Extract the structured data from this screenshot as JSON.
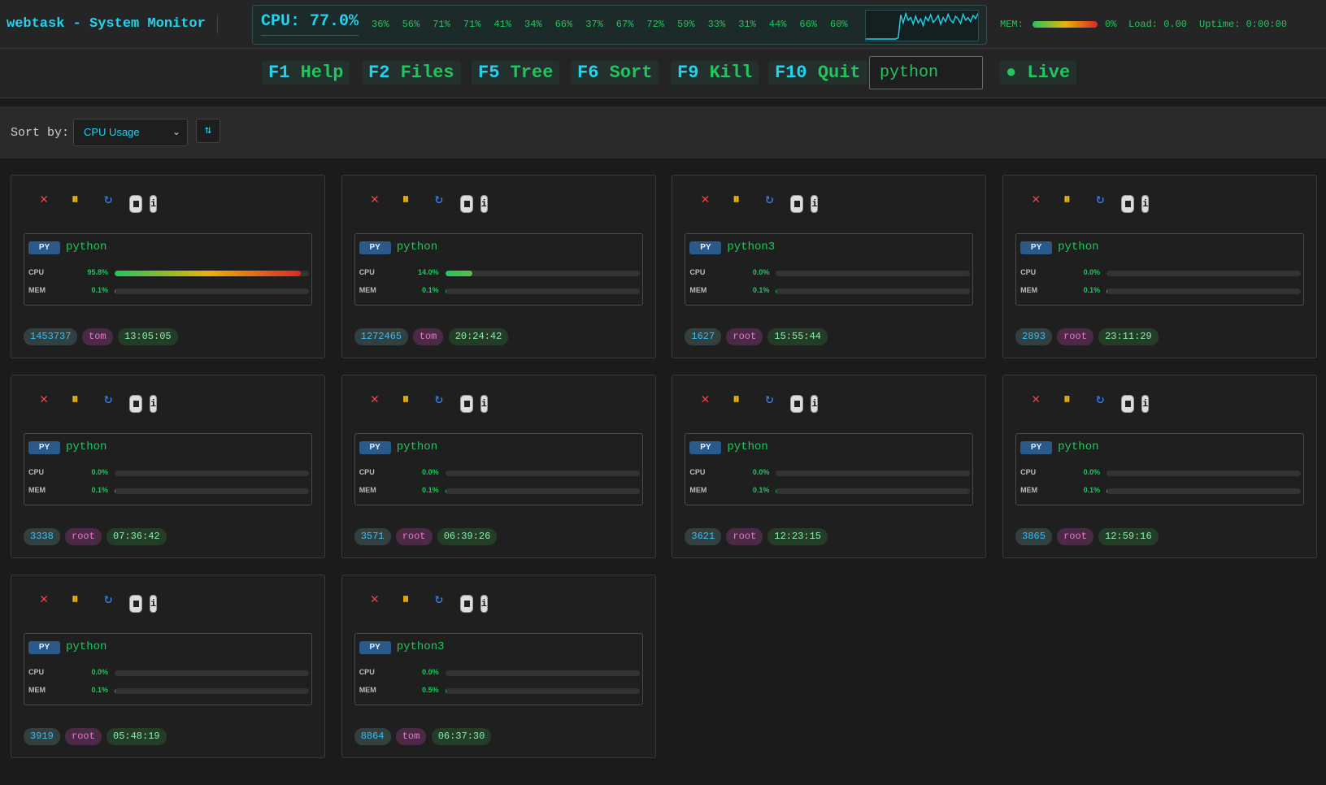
{
  "app": {
    "title": "webtask - System Monitor"
  },
  "cpu": {
    "total_label": "CPU: 77.0%",
    "cores": [
      "36%",
      "56%",
      "71%",
      "71%",
      "41%",
      "34%",
      "66%",
      "37%",
      "67%",
      "72%",
      "59%",
      "33%",
      "31%",
      "44%",
      "66%",
      "60%"
    ],
    "history": [
      0,
      0,
      0,
      0,
      0,
      0,
      0,
      0,
      0,
      0,
      0,
      0,
      0,
      5,
      90,
      60,
      95,
      70,
      80,
      55,
      85,
      60,
      75,
      50,
      82,
      68,
      90,
      62,
      72,
      88,
      55,
      80,
      65,
      92,
      70,
      60,
      85,
      75,
      58,
      92,
      70,
      80,
      65,
      88,
      76,
      95
    ]
  },
  "mem": {
    "label": "MEM:",
    "value": "0%",
    "load": "Load: 0.00",
    "uptime": "Uptime: 0:00:00"
  },
  "fkeys": [
    {
      "key": "F1",
      "label": "Help"
    },
    {
      "key": "F2",
      "label": "Files"
    },
    {
      "key": "F5",
      "label": "Tree"
    },
    {
      "key": "F6",
      "label": "Sort"
    },
    {
      "key": "F9",
      "label": "Kill"
    },
    {
      "key": "F10",
      "label": "Quit"
    }
  ],
  "search": {
    "value": "python"
  },
  "live": {
    "label": "● Live"
  },
  "sort": {
    "label": "Sort by:",
    "selected": "CPU Usage",
    "direction_icon": "⇅"
  },
  "colors": {
    "accent": "#22d3ee",
    "green": "#22c55e",
    "kill": "#ef4444",
    "pause": "#eab308",
    "restart": "#3b82f6"
  },
  "processes": [
    {
      "badge": "PY",
      "name": "python",
      "cpu_label": "CPU",
      "cpu": "95.8%",
      "cpu_frac": 0.958,
      "mem_label": "MEM",
      "mem": "0.1%",
      "mem_frac": 0.001,
      "pid": "1453737",
      "user": "tom",
      "time": "13:05:05"
    },
    {
      "badge": "PY",
      "name": "python",
      "cpu_label": "CPU",
      "cpu": "14.0%",
      "cpu_frac": 0.14,
      "mem_label": "MEM",
      "mem": "0.1%",
      "mem_frac": 0.001,
      "pid": "1272465",
      "user": "tom",
      "time": "20:24:42"
    },
    {
      "badge": "PY",
      "name": "python3",
      "cpu_label": "CPU",
      "cpu": "0.0%",
      "cpu_frac": 0,
      "mem_label": "MEM",
      "mem": "0.1%",
      "mem_frac": 0.001,
      "pid": "1627",
      "user": "root",
      "time": "15:55:44"
    },
    {
      "badge": "PY",
      "name": "python",
      "cpu_label": "CPU",
      "cpu": "0.0%",
      "cpu_frac": 0,
      "mem_label": "MEM",
      "mem": "0.1%",
      "mem_frac": 0.001,
      "pid": "2893",
      "user": "root",
      "time": "23:11:29"
    },
    {
      "badge": "PY",
      "name": "python",
      "cpu_label": "CPU",
      "cpu": "0.0%",
      "cpu_frac": 0,
      "mem_label": "MEM",
      "mem": "0.1%",
      "mem_frac": 0.001,
      "pid": "3338",
      "user": "root",
      "time": "07:36:42"
    },
    {
      "badge": "PY",
      "name": "python",
      "cpu_label": "CPU",
      "cpu": "0.0%",
      "cpu_frac": 0,
      "mem_label": "MEM",
      "mem": "0.1%",
      "mem_frac": 0.001,
      "pid": "3571",
      "user": "root",
      "time": "06:39:26"
    },
    {
      "badge": "PY",
      "name": "python",
      "cpu_label": "CPU",
      "cpu": "0.0%",
      "cpu_frac": 0,
      "mem_label": "MEM",
      "mem": "0.1%",
      "mem_frac": 0.001,
      "pid": "3621",
      "user": "root",
      "time": "12:23:15"
    },
    {
      "badge": "PY",
      "name": "python",
      "cpu_label": "CPU",
      "cpu": "0.0%",
      "cpu_frac": 0,
      "mem_label": "MEM",
      "mem": "0.1%",
      "mem_frac": 0.001,
      "pid": "3865",
      "user": "root",
      "time": "12:59:16"
    },
    {
      "badge": "PY",
      "name": "python",
      "cpu_label": "CPU",
      "cpu": "0.0%",
      "cpu_frac": 0,
      "mem_label": "MEM",
      "mem": "0.1%",
      "mem_frac": 0.001,
      "pid": "3919",
      "user": "root",
      "time": "05:48:19"
    },
    {
      "badge": "PY",
      "name": "python3",
      "cpu_label": "CPU",
      "cpu": "0.0%",
      "cpu_frac": 0,
      "mem_label": "MEM",
      "mem": "0.5%",
      "mem_frac": 0.005,
      "pid": "8864",
      "user": "tom",
      "time": "06:37:30"
    }
  ]
}
